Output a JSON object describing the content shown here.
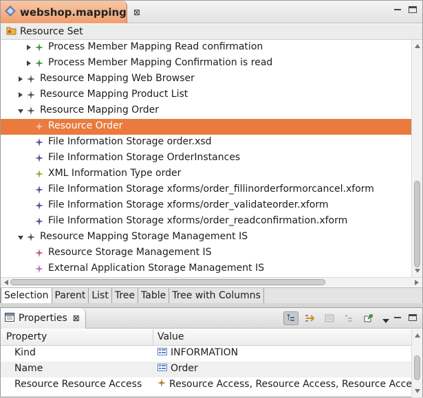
{
  "editor": {
    "tab_title": "webshop.mapping",
    "tab_close": "⊠",
    "resource_set_label": "Resource Set",
    "tree": [
      {
        "label": "Process Member Mapping Read confirmation",
        "twisty": "collapsed",
        "level": 2,
        "icon_color": "#3a9a3a"
      },
      {
        "label": "Process Member Mapping Confirmation is read",
        "twisty": "collapsed",
        "level": 2,
        "icon_color": "#3a9a3a"
      },
      {
        "label": "Resource Mapping Web Browser",
        "twisty": "collapsed",
        "level": 1,
        "icon_color": "#555555"
      },
      {
        "label": "Resource Mapping Product List",
        "twisty": "collapsed",
        "level": 1,
        "icon_color": "#555555"
      },
      {
        "label": "Resource Mapping Order",
        "twisty": "expanded",
        "level": 1,
        "icon_color": "#555555"
      },
      {
        "label": "Resource Order",
        "twisty": "none",
        "level": 2,
        "icon_color": "#f2c0c0",
        "selected": true
      },
      {
        "label": "File Information Storage order.xsd",
        "twisty": "none",
        "level": 2,
        "icon_color": "#5a4f9e"
      },
      {
        "label": "File Information Storage OrderInstances",
        "twisty": "none",
        "level": 2,
        "icon_color": "#5a4f9e"
      },
      {
        "label": "XML Information Type order",
        "twisty": "none",
        "level": 2,
        "icon_color": "#a9a23a"
      },
      {
        "label": "File Information Storage xforms/order_fillinorderformorcancel.xform",
        "twisty": "none",
        "level": 2,
        "icon_color": "#5a4f9e"
      },
      {
        "label": "File Information Storage xforms/order_validateorder.xform",
        "twisty": "none",
        "level": 2,
        "icon_color": "#5a4f9e"
      },
      {
        "label": "File Information Storage xforms/order_readconfirmation.xform",
        "twisty": "none",
        "level": 2,
        "icon_color": "#5a4f9e"
      },
      {
        "label": "Resource Mapping Storage Management IS",
        "twisty": "expanded",
        "level": 1,
        "icon_color": "#555555"
      },
      {
        "label": "Resource Storage Management IS",
        "twisty": "none",
        "level": 2,
        "icon_color": "#c45a80"
      },
      {
        "label": "External Application Storage Management IS",
        "twisty": "none",
        "level": 2,
        "icon_color": "#c070c0"
      }
    ],
    "page_tabs": [
      "Selection",
      "Parent",
      "List",
      "Tree",
      "Table",
      "Tree with Columns"
    ],
    "active_page_tab": 0
  },
  "properties": {
    "tab_title": "Properties",
    "tab_close": "⊠",
    "columns": [
      "Property",
      "Value"
    ],
    "rows": [
      {
        "property": "Kind",
        "value": "INFORMATION",
        "icon": "enum-literal-icon"
      },
      {
        "property": "Name",
        "value": "Order",
        "icon": "enum-literal-icon"
      },
      {
        "property": "Resource Resource Access",
        "value": "Resource Access, Resource Access, Resource Access",
        "icon": "resource-access-icon"
      }
    ]
  },
  "colors": {
    "accent": "#ea7a3e",
    "selected_text": "#ffffff"
  }
}
